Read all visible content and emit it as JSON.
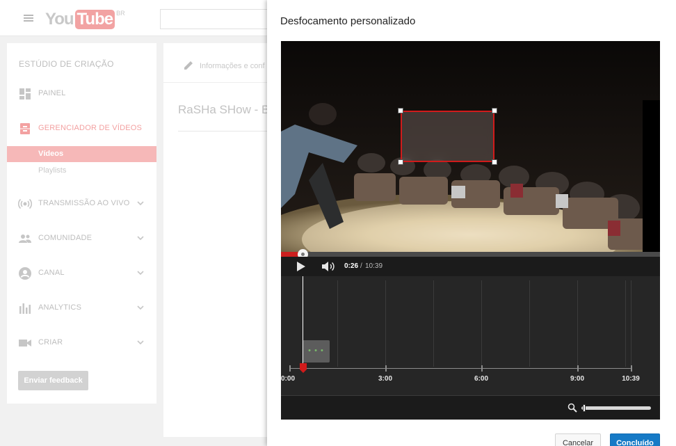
{
  "header": {
    "logo_you": "You",
    "logo_tube": "Tube",
    "logo_region": "BR"
  },
  "sidebar": {
    "title": "ESTÚDIO DE CRIAÇÃO",
    "items": [
      {
        "label": "PAINEL",
        "icon": "dashboard-icon"
      },
      {
        "label": "GERENCIADOR DE VÍDEOS",
        "icon": "video-manager-icon"
      },
      {
        "label": "TRANSMISSÃO AO VIVO",
        "icon": "live-broadcast-icon"
      },
      {
        "label": "COMUNIDADE",
        "icon": "community-icon"
      },
      {
        "label": "CANAL",
        "icon": "channel-icon"
      },
      {
        "label": "ANALYTICS",
        "icon": "analytics-icon"
      },
      {
        "label": "CRIAR",
        "icon": "create-icon"
      }
    ],
    "sub_items": [
      {
        "label": "Vídeos",
        "active": true
      },
      {
        "label": "Playlists",
        "active": false
      }
    ],
    "feedback_button": "Enviar feedback"
  },
  "main": {
    "tab_info": "Informações e conf",
    "video_title": "RaSHa SHow - B"
  },
  "dialog": {
    "title": "Desfocamento personalizado",
    "player": {
      "current_time": "0:26",
      "separator": "/",
      "duration": "10:39",
      "progress_fraction": 0.042
    },
    "timeline": {
      "labels": [
        "0:00",
        "3:00",
        "6:00",
        "9:00",
        "10:39"
      ],
      "playhead_fraction": 0.042
    },
    "zoom_fraction": 0.02,
    "cancel_button": "Cancelar",
    "done_button": "Concluído"
  },
  "colors": {
    "accent_red": "#cc1f1f",
    "primary_blue": "#167ac6",
    "blur_border": "#d11b1b"
  }
}
